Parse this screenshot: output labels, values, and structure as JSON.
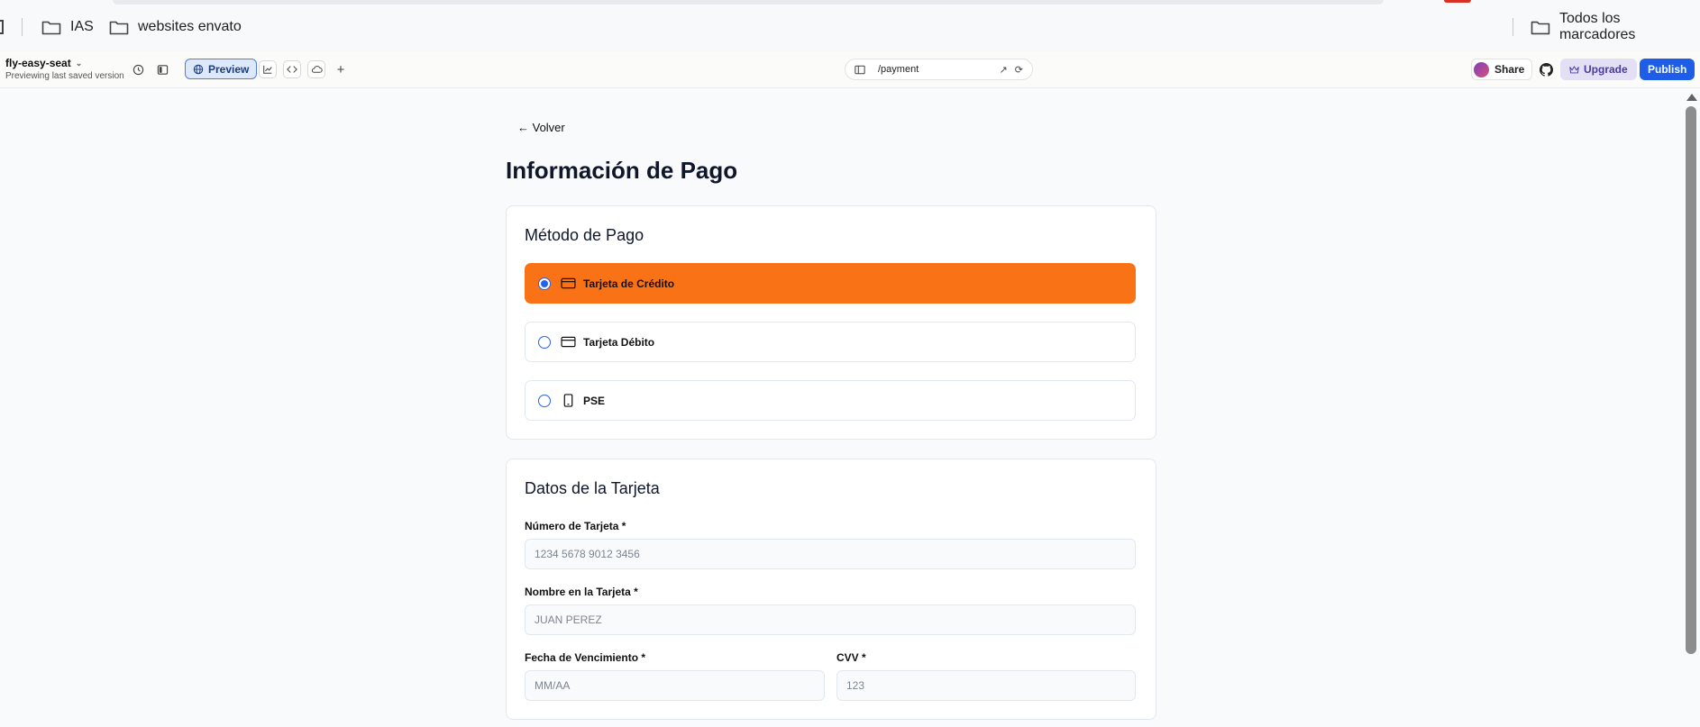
{
  "bookmarks": {
    "items": [
      {
        "label": "IAS",
        "icon": "folder-icon"
      },
      {
        "label": "websites envato",
        "icon": "folder-icon"
      }
    ],
    "all_bookmarks_label": "Todos los marcadores"
  },
  "toolbar": {
    "project_name": "fly-easy-seat",
    "project_subtitle": "Previewing last saved version",
    "preview_label": "Preview",
    "url_path": "/payment",
    "share_label": "Share",
    "upgrade_label": "Upgrade",
    "publish_label": "Publish"
  },
  "page": {
    "back_label": "← Volver",
    "title": "Información de Pago",
    "payment_method": {
      "title": "Método de Pago",
      "options": [
        {
          "label": "Tarjeta de Crédito",
          "icon": "credit-card-icon",
          "selected": true
        },
        {
          "label": "Tarjeta Débito",
          "icon": "credit-card-icon",
          "selected": false
        },
        {
          "label": "PSE",
          "icon": "smartphone-icon",
          "selected": false
        }
      ]
    },
    "card_data": {
      "title": "Datos de la Tarjeta",
      "card_number": {
        "label": "Número de Tarjeta *",
        "placeholder": "1234 5678 9012 3456",
        "value": ""
      },
      "card_name": {
        "label": "Nombre en la Tarjeta *",
        "placeholder": "JUAN PEREZ",
        "value": ""
      },
      "expiry": {
        "label": "Fecha de Vencimiento *",
        "placeholder": "MM/AA",
        "value": ""
      },
      "cvv": {
        "label": "CVV *",
        "placeholder": "123",
        "value": ""
      }
    }
  },
  "colors": {
    "accent_selected": "#f97316",
    "radio": "#2563eb",
    "publish": "#1d5de8",
    "upgrade_bg": "#e3e0f5"
  }
}
